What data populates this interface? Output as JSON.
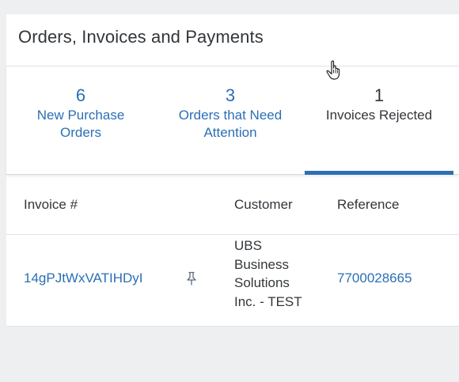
{
  "card": {
    "title": "Orders, Invoices and Payments"
  },
  "tabs": [
    {
      "count": "6",
      "label": "New Purchase Orders",
      "selected": false
    },
    {
      "count": "3",
      "label": "Orders that Need Attention",
      "selected": false
    },
    {
      "count": "1",
      "label": "Invoices Rejected",
      "selected": true
    }
  ],
  "table": {
    "columns": [
      "Invoice #",
      "Customer",
      "Reference"
    ],
    "rows": [
      {
        "invoice": "14gPJtWxVATIHDyI",
        "customer": "UBS Business Solutions Inc. - TEST",
        "reference": "7700028665"
      }
    ]
  },
  "colors": {
    "accent": "#2b6fb5",
    "background": "#edeff0",
    "text": "#32363a"
  },
  "icons": {
    "pin": "pin-icon",
    "cursor": "hand-pointer-cursor-icon"
  }
}
